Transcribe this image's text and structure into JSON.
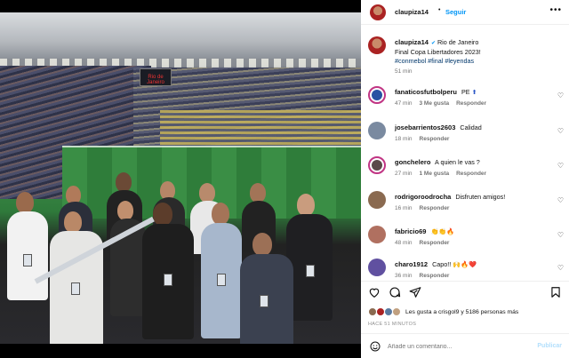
{
  "post": {
    "username": "claupiza14",
    "follow_label": "Seguir",
    "more_icon": "more-options-icon",
    "caption": {
      "text": "Rio de Janeiro\nFinal Copa Libertadores 2023!",
      "hashtags": "#conmebol #final #leyendas",
      "time": "51 min"
    },
    "photo_text": "Rio de Janeiro"
  },
  "comments": [
    {
      "username": "fanaticosfutbolperu",
      "text": "PE",
      "time": "47 min",
      "likes": "3 Me gusta",
      "reply": "Responder",
      "avatar_color": "#2952a3"
    },
    {
      "username": "josebarrientos2603",
      "text": "Calidad",
      "time": "18 min",
      "likes": "",
      "reply": "Responder",
      "avatar_color": "#7a8aa0"
    },
    {
      "username": "gonchelero",
      "text": "A quien le vas ?",
      "time": "27 min",
      "likes": "1 Me gusta",
      "reply": "Responder",
      "avatar_color": "#5a4a4a"
    },
    {
      "username": "rodrigoroodrocha",
      "text": "Disfruten amigos!",
      "time": "16 min",
      "likes": "",
      "reply": "Responder",
      "avatar_color": "#8a6a50"
    },
    {
      "username": "fabricio69",
      "text": "👏👏🔥",
      "time": "48 min",
      "likes": "",
      "reply": "Responder",
      "avatar_color": "#b07060"
    },
    {
      "username": "charo1912",
      "text": "Capo!! 🙌🔥❤️",
      "time": "36 min",
      "likes": "",
      "reply": "Responder",
      "avatar_color": "#6050a0"
    }
  ],
  "actions": {
    "like_icon": "heart-icon",
    "comment_icon": "comment-icon",
    "share_icon": "share-icon",
    "save_icon": "bookmark-icon"
  },
  "likes_summary": "Les gusta a crisgol9 y 5186 personas más",
  "post_time": "HACE 51 MINUTOS",
  "composer": {
    "placeholder": "Añade un comentario...",
    "post_label": "Publicar",
    "emoji_icon": "emoji-icon"
  },
  "colors": {
    "accent": "#0095f6",
    "link": "#00376b",
    "muted": "#737373"
  }
}
